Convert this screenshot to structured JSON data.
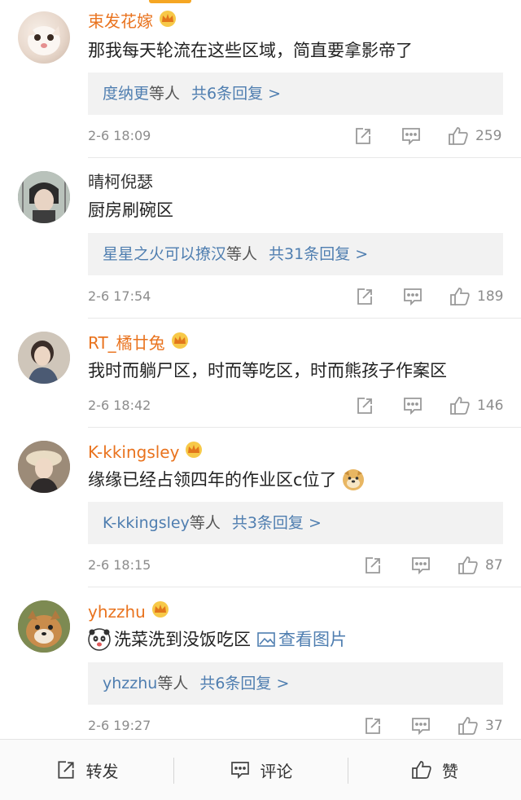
{
  "comments": [
    {
      "username": "束发花嫁",
      "vip": true,
      "text": "那我每天轮流在这些区域，简直要拿影帝了",
      "reply_names": "度纳更",
      "reply_etal": "等人",
      "reply_count": "共6条回复 >",
      "time": "2-6 18:09",
      "likes": "259"
    },
    {
      "username": "晴柯倪瑟",
      "vip": false,
      "text": "厨房刷碗区",
      "reply_names": "星星之火可以撩汉",
      "reply_etal": "等人",
      "reply_count": "共31条回复 >",
      "time": "2-6 17:54",
      "likes": "189"
    },
    {
      "username": "RT_橘廿兔",
      "vip": true,
      "text": "我时而躺尸区，时而等吃区，时而熊孩子作案区",
      "time": "2-6 18:42",
      "likes": "146"
    },
    {
      "username": "K-kkingsley",
      "vip": true,
      "text": "缘缘已经占领四年的作业区c位了",
      "reply_names": "K-kkingsley",
      "reply_etal": "等人",
      "reply_count": "共3条回复 >",
      "time": "2-6 18:15",
      "likes": "87"
    },
    {
      "username": "yhzzhu",
      "vip": true,
      "text": "洗菜洗到没饭吃区",
      "view_image": "查看图片",
      "reply_names": "yhzzhu",
      "reply_etal": "等人",
      "reply_count": "共6条回复 >",
      "time": "2-6 19:27",
      "likes": "37"
    }
  ],
  "bottom_bar": {
    "repost": "转发",
    "comment": "评论",
    "like": "赞"
  },
  "colors": {
    "vip_name": "#e9731e",
    "link": "#4f7eb0",
    "meta": "#8c8c8c"
  }
}
